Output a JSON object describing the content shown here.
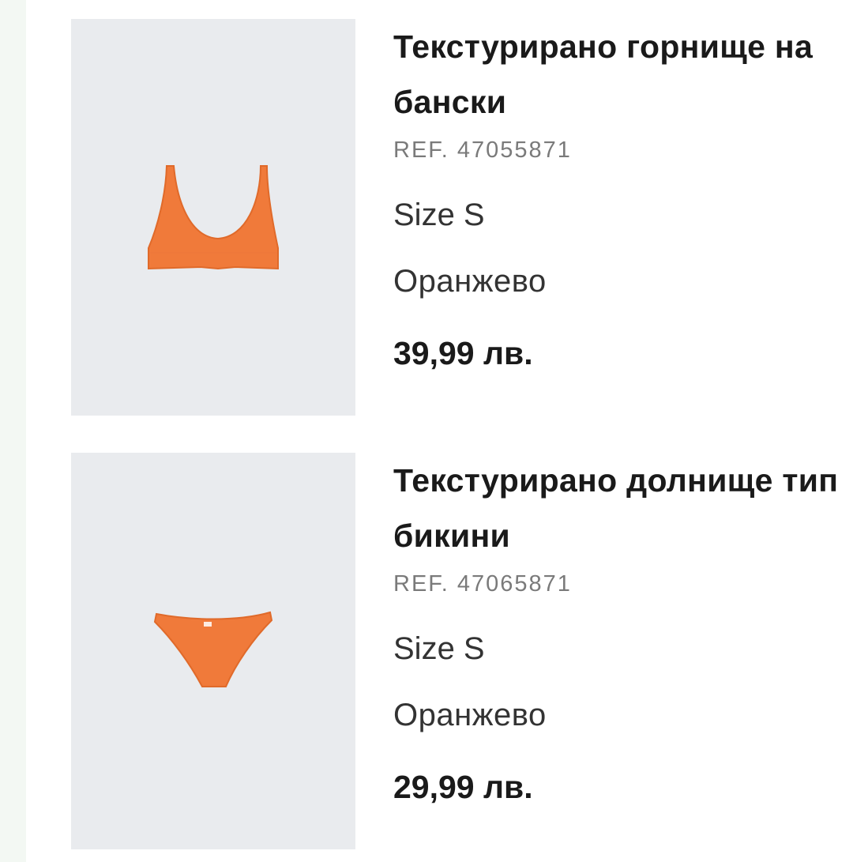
{
  "products": [
    {
      "title": "Текстурирано горнище на бански",
      "ref": "REF. 47055871",
      "size": "Size S",
      "color_name": "Оранжево",
      "price": "39,99 лв.",
      "image_icon": "bikini-top-image",
      "garment_color": "#f07a3a"
    },
    {
      "title": "Текстурирано долнище тип бикини",
      "ref": "REF. 47065871",
      "size": "Size S",
      "color_name": "Оранжево",
      "price": "29,99 лв.",
      "image_icon": "bikini-bottom-image",
      "garment_color": "#f07a3a"
    }
  ]
}
